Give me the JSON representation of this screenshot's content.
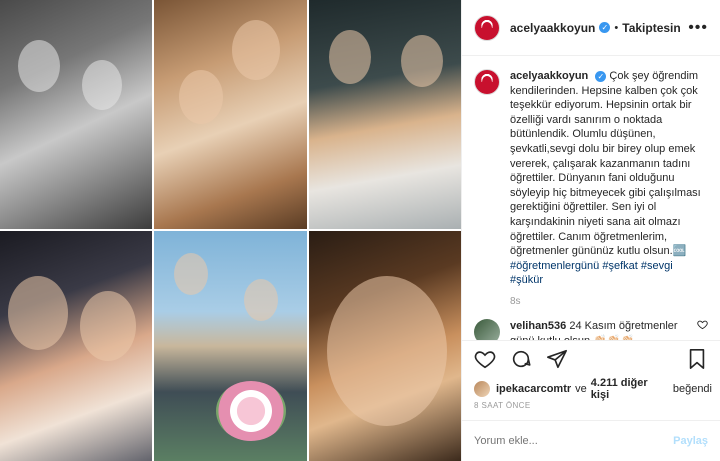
{
  "header": {
    "username": "acelyaakkoyun",
    "separator": "•",
    "follow_status": "Takiptesin"
  },
  "caption": {
    "username": "acelyaakkoyun",
    "text": "Çok şey öğrendim kendilerinden. Hepsine kalben çok çok teşekkür ediyorum. Hepsinin ortak bir özelliği vardı sanırım o noktada bütünlendik. Olumlu düşünen, şevkatli,sevgi dolu bir birey olup emek vererek, çalışarak kazanmanın tadını öğrettiler. Dünyanın fani olduğunu söyleyip hiç bitmeyecek gibi çalışılması gerektiğini öğrettiler. Sen iyi ol karşındakinin niyeti sana ait olmazı öğrettiler. Canım öğretmenlerim, öğretmenler gününüz kutlu olsun.🆒",
    "hashtags": [
      "#öğretmenlergünü",
      "#şefkat",
      "#sevgi",
      "#şükür"
    ],
    "time": "8s"
  },
  "comment": {
    "username": "velihan536",
    "text": "24 Kasım öğretmenler günü kutlu olsun 👏🏻👏🏻👏🏻"
  },
  "likes": {
    "first_user": "ipekacarcomtr",
    "connector": "ve",
    "others": "4.211 diğer kişi",
    "suffix": "beğendi"
  },
  "post_time": "8 SAAT ÖNCE",
  "add_comment": {
    "placeholder": "Yorum ekle...",
    "post_label": "Paylaş"
  },
  "icons": {
    "like": "heart-icon",
    "comment": "comment-icon",
    "share": "share-icon",
    "save": "bookmark-icon",
    "more": "more-icon"
  },
  "colors": {
    "verified": "#3897f0",
    "hashtag": "#003569",
    "post_button": "#b2dffc",
    "muted": "#999999"
  }
}
